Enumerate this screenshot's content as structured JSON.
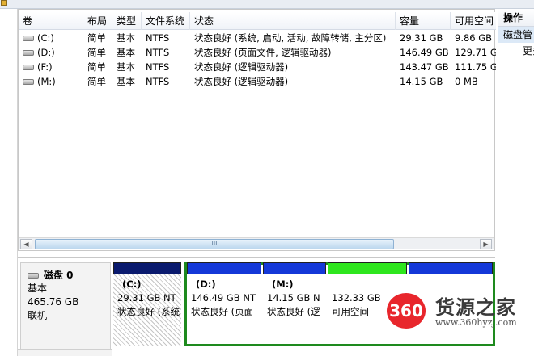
{
  "volume_table": {
    "headers": [
      "卷",
      "布局",
      "类型",
      "文件系统",
      "状态",
      "容量",
      "可用空间"
    ],
    "rows": [
      {
        "volume": "(C:)",
        "layout": "简单",
        "type": "基本",
        "fs": "NTFS",
        "status": "状态良好 (系统, 启动, 活动, 故障转储, 主分区)",
        "capacity": "29.31 GB",
        "free": "9.86 GB"
      },
      {
        "volume": "(D:)",
        "layout": "简单",
        "type": "基本",
        "fs": "NTFS",
        "status": "状态良好 (页面文件, 逻辑驱动器)",
        "capacity": "146.49 GB",
        "free": "129.71 G"
      },
      {
        "volume": "(F:)",
        "layout": "简单",
        "type": "基本",
        "fs": "NTFS",
        "status": "状态良好 (逻辑驱动器)",
        "capacity": "143.47 GB",
        "free": "111.75 G"
      },
      {
        "volume": "(M:)",
        "layout": "简单",
        "type": "基本",
        "fs": "NTFS",
        "status": "状态良好 (逻辑驱动器)",
        "capacity": "14.15 GB",
        "free": "0 MB"
      }
    ],
    "scroll_grip": "III"
  },
  "actions_pane": {
    "title": "操作",
    "selected": "磁盘管",
    "more": "更多"
  },
  "disk": {
    "name": "磁盘 0",
    "type": "基本",
    "size": "465.76 GB",
    "state": "联机"
  },
  "partitions": [
    {
      "label": "(C:)",
      "size": "29.31 GB NT",
      "status": "状态良好 (系统"
    },
    {
      "label": "(D:)",
      "size": "146.49 GB NT",
      "status": "状态良好 (页面"
    },
    {
      "label": "(M:)",
      "size": "14.15 GB N",
      "status": "状态良好 (逻"
    },
    {
      "label": "",
      "size": "132.33 GB",
      "status": "可用空间"
    },
    {
      "label": "",
      "size": "",
      "status": ""
    }
  ],
  "colors": {
    "primary_partition": "#0a1a6e",
    "logical_partition": "#1438d8",
    "free_space": "#2ee61e",
    "extended_frame": "#1e8a1e",
    "watermark_badge": "#e8262c"
  },
  "watermark": {
    "badge": "360",
    "text": "货源之家",
    "url": "www.360hyzj.com"
  }
}
